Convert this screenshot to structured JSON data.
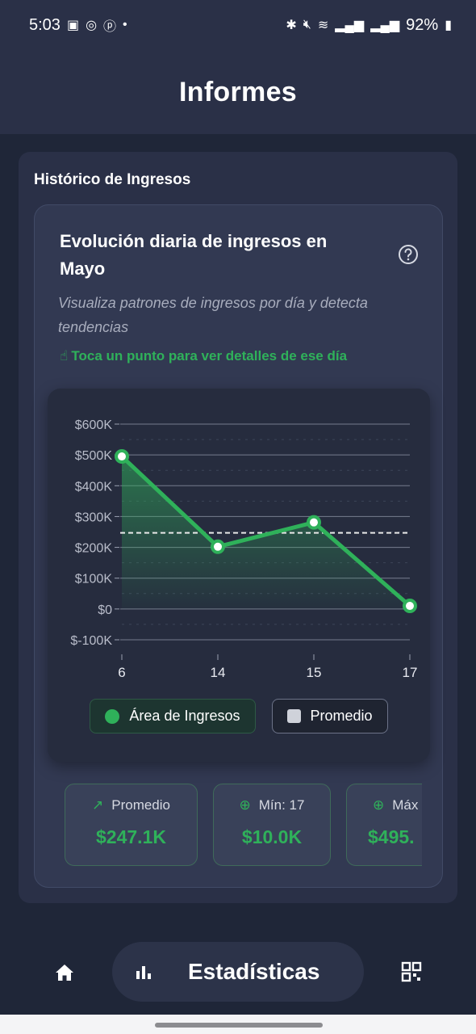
{
  "status_bar": {
    "time": "5:03",
    "battery": "92%"
  },
  "header": {
    "title": "Informes"
  },
  "section": {
    "title": "Histórico de Ingresos"
  },
  "chart_card": {
    "title": "Evolución diaria de ingresos en Mayo",
    "subtitle": "Visualiza patrones de ingresos por día y detecta tendencias",
    "hint": "Toca un punto para ver detalles de ese día"
  },
  "chart_data": {
    "type": "area",
    "x": [
      "6",
      "14",
      "15",
      "17"
    ],
    "series": [
      {
        "name": "Área de Ingresos",
        "values": [
          495000,
          202000,
          281000,
          10000
        ],
        "color": "#2fb15a"
      },
      {
        "name": "Promedio",
        "values": [
          247100,
          247100,
          247100,
          247100
        ],
        "color": "#e8e8e8",
        "style": "dashed"
      }
    ],
    "y_ticks": [
      "$600K",
      "$500K",
      "$400K",
      "$300K",
      "$200K",
      "$100K",
      "$0",
      "$-100K"
    ],
    "ylim": [
      -100000,
      600000
    ],
    "grid": true,
    "legend_position": "bottom"
  },
  "legend": {
    "income_label": "Área de Ingresos",
    "average_label": "Promedio"
  },
  "stats": [
    {
      "label": "Promedio",
      "value": "$247.1K",
      "icon": "trend-up-icon"
    },
    {
      "label": "Mín: 17",
      "value": "$10.0K",
      "icon": "arrow-down-circle-icon"
    },
    {
      "label": "Máx",
      "value": "$495.",
      "icon": "arrow-up-circle-icon"
    }
  ],
  "bottom_nav": {
    "active_label": "Estadísticas"
  },
  "colors": {
    "accent_green": "#2fb15a",
    "background": "#1f2638",
    "card": "#323952"
  }
}
